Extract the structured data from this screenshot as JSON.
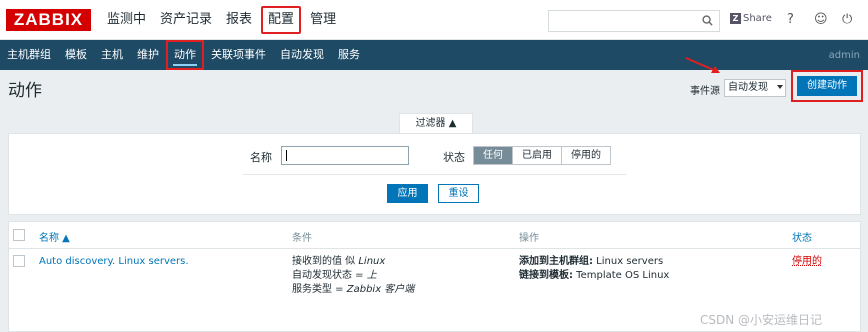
{
  "header": {
    "logo": "ZABBIX",
    "menu": [
      "监测中",
      "资产记录",
      "报表",
      "配置",
      "管理"
    ],
    "share": "Share",
    "help": "?",
    "user": "☺",
    "logout": "⏻"
  },
  "subnav": {
    "items": [
      "主机群组",
      "模板",
      "主机",
      "维护",
      "动作",
      "关联项事件",
      "自动发现",
      "服务"
    ],
    "user": "admin"
  },
  "page": {
    "title": "动作",
    "event_source_label": "事件源",
    "event_source_value": "自动发现",
    "create_button": "创建动作"
  },
  "filter": {
    "tab_label": "过滤器 ▲",
    "name_label": "名称",
    "name_value": "",
    "status_label": "状态",
    "status_options": [
      "任何",
      "已启用",
      "停用的"
    ],
    "apply": "应用",
    "reset": "重设"
  },
  "table": {
    "headers": {
      "name": "名称 ▲",
      "conditions": "条件",
      "operations": "操作",
      "status": "状态"
    },
    "rows": [
      {
        "name": "Auto discovery. Linux servers.",
        "conditions": [
          {
            "prefix": "接收到的值 似 ",
            "value": "Linux"
          },
          {
            "prefix": "自动发现状态 = ",
            "value": "上"
          },
          {
            "prefix": "服务类型 = ",
            "value": "Zabbix 客户端"
          }
        ],
        "operations": [
          {
            "label": "添加到主机群组:",
            "value": " Linux servers"
          },
          {
            "label": "链接到模板:",
            "value": " Template OS Linux"
          }
        ],
        "status": "停用的"
      }
    ]
  },
  "watermark": "CSDN @小安运维日记",
  "colors": {
    "brand": "#d40000",
    "nav": "#1e4a66",
    "primary": "#0275b8",
    "annotation": "#e02020"
  }
}
